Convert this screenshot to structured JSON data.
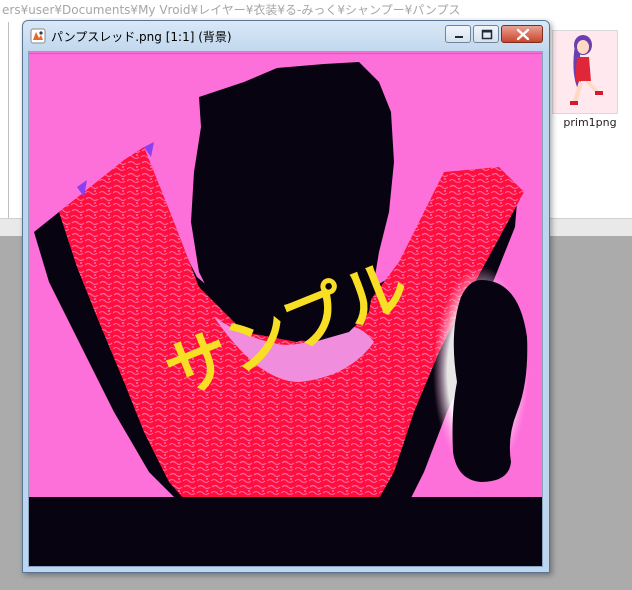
{
  "background_window": {
    "path": "ers¥user¥Documents¥My Vroid¥レイヤー¥衣装¥る-みっく¥シャンプー¥パンプス",
    "thumbnail_label": "prim1png"
  },
  "image_window": {
    "title": "パンプスレッド.png [1:1] (背景)",
    "controls": [
      "minimize",
      "maximize",
      "close"
    ]
  },
  "image": {
    "watermark_text": "サンプル",
    "colors": {
      "background_pink": "#fd6fd9",
      "red": "#ff0f3e",
      "black": "#080310",
      "yellow": "#f8df23",
      "light_pink": "#ff9adf"
    }
  }
}
